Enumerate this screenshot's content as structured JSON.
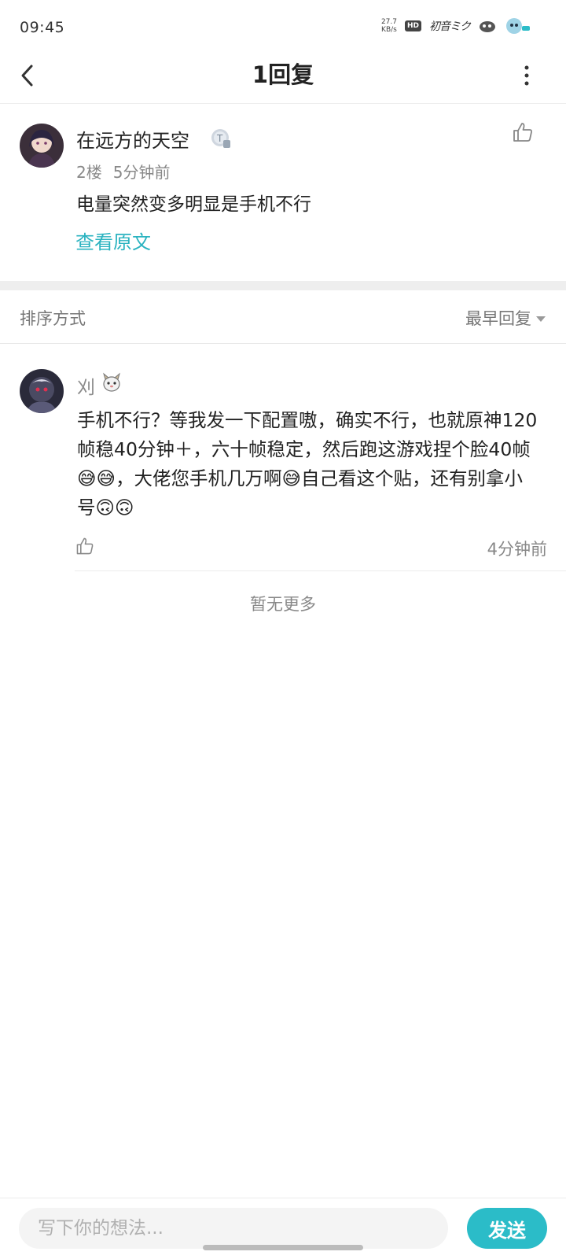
{
  "status_bar": {
    "time": "09:45",
    "net_speed_value": "27.7",
    "net_speed_unit": "KB/s",
    "hd_label": "HD",
    "logo_text": "初音ミク"
  },
  "header": {
    "title": "1回复",
    "back_icon": "chevron-left-icon",
    "more_icon": "vertical-dots-icon"
  },
  "main_post": {
    "author": "在远方的天空",
    "floor": "2楼",
    "time": "5分钟前",
    "content": "电量突然变多明显是手机不行",
    "view_original_label": "查看原文",
    "like_icon": "thumbs-up-icon"
  },
  "sort_bar": {
    "label": "排序方式",
    "selected": "最早回复"
  },
  "reply": {
    "author": "刈",
    "content": "手机不行？等我发一下配置嗷，确实不行，也就原神120帧稳40分钟＋，六十帧稳定，然后跑这游戏捏个脸40帧😅😅，大佬您手机几万啊😅自己看这个贴，还有别拿小号🙃🙃",
    "time": "4分钟前",
    "like_icon": "thumbs-up-icon"
  },
  "footer": {
    "no_more": "暂无更多"
  },
  "input_bar": {
    "placeholder": "写下你的想法...",
    "send_label": "发送"
  },
  "colors": {
    "accent": "#2bbcc8",
    "link": "#2bb3c0"
  }
}
